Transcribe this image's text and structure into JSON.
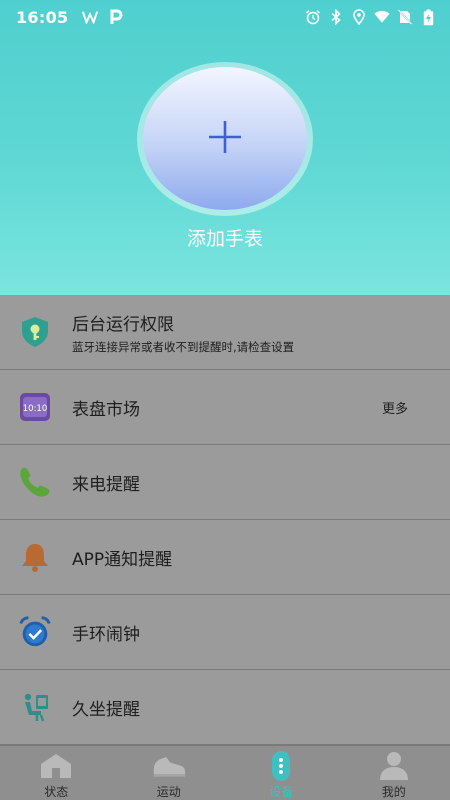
{
  "status_bar": {
    "time": "16:05",
    "left_icons": [
      "w-logo-icon",
      "p-logo-icon"
    ],
    "right_icons": [
      "alarm-icon",
      "bluetooth-icon",
      "location-icon",
      "wifi-icon",
      "no-sim-icon",
      "battery-charging-icon"
    ]
  },
  "hero": {
    "add_label": "添加手表",
    "add_icon": "plus-icon"
  },
  "menu": {
    "items": [
      {
        "title": "后台运行权限",
        "subtitle": "蓝牙连接异常或者收不到提醒时,请检查设置",
        "icon": "shield-key-icon",
        "more": ""
      },
      {
        "title": "表盘市场",
        "subtitle": "",
        "icon": "watch-face-icon",
        "more": "更多",
        "icon_text": "10:10"
      },
      {
        "title": "来电提醒",
        "subtitle": "",
        "icon": "phone-icon",
        "more": ""
      },
      {
        "title": "APP通知提醒",
        "subtitle": "",
        "icon": "bell-icon",
        "more": ""
      },
      {
        "title": "手环闹钟",
        "subtitle": "",
        "icon": "alarm-clock-icon",
        "more": ""
      },
      {
        "title": "久坐提醒",
        "subtitle": "",
        "icon": "sitting-person-icon",
        "more": ""
      }
    ]
  },
  "bottom_nav": {
    "items": [
      {
        "label": "状态",
        "icon": "home-icon"
      },
      {
        "label": "运动",
        "icon": "shoe-icon"
      },
      {
        "label": "设备",
        "icon": "band-icon"
      },
      {
        "label": "我的",
        "icon": "person-icon"
      }
    ],
    "active_index": 2,
    "active_color": "#3fbfc2"
  },
  "colors": {
    "hero_top": "#4fcfcf",
    "hero_bottom": "#7be5df",
    "list_bg": "#9b9b9b",
    "plus": "#3d5fd6"
  }
}
